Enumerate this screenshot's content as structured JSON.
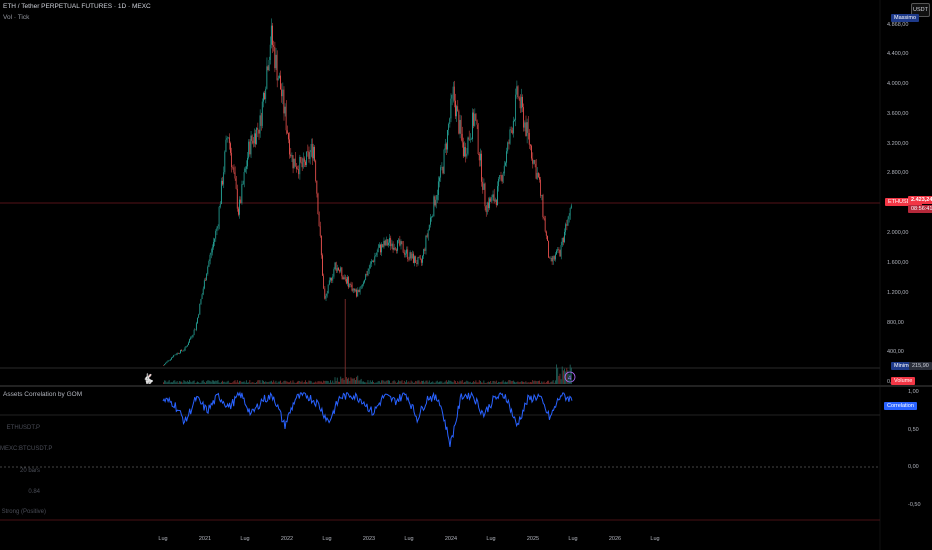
{
  "header": {
    "symbol_title": "ETH / Tether PERPETUAL FUTURES · 1D · MEXC",
    "sub_label": "Vol · Tick"
  },
  "currency_button": "USDT",
  "price_axis": {
    "ticks": [
      "4.400,00",
      "4.000,00",
      "3.600,00",
      "3.200,00",
      "2.800,00",
      "2.000,00",
      "1.600,00",
      "1.200,00",
      "800,00",
      "400,00",
      "0,00"
    ],
    "max_tag": "Massimo",
    "max_value": "4.868,00",
    "min_tag": "Minimo",
    "min_value": "215,90",
    "volume_tag": "Volume",
    "last_tag": "ETHUSDT.P",
    "last_price": "2.423,24",
    "countdown": "08:56:41"
  },
  "indicator": {
    "title": "Assets Correlation by GOM",
    "legend_tag": "Correlation",
    "axis_ticks": [
      "1,00",
      "0,50",
      "0,00",
      "-0,50"
    ],
    "table": [
      "ETHUSDT.P",
      "MEXC:BTCUSDT.P",
      "20 bars",
      "0.84",
      "Strong (Positive)"
    ]
  },
  "x_axis": [
    "Lug",
    "2021",
    "Lug",
    "2022",
    "Lug",
    "2023",
    "Lug",
    "2024",
    "Lug",
    "2025",
    "Lug",
    "2026",
    "Lug"
  ],
  "colors": {
    "background": "#000000",
    "up": "#26a69a",
    "down": "#ef5350",
    "correlation_line": "#2962ff",
    "max_tag": "#1e3a8a",
    "last_price_tag": "#f23645",
    "volume_tag": "#f23645"
  },
  "chart_data": [
    {
      "type": "candlestick",
      "title": "ETH / Tether PERPETUAL FUTURES · 1D · MEXC",
      "ylim": [
        0,
        4868
      ],
      "x": [
        "2020-07",
        "2020-09",
        "2020-11",
        "2021-01",
        "2021-02",
        "2021-04",
        "2021-05",
        "2021-06",
        "2021-08",
        "2021-09",
        "2021-11",
        "2021-12",
        "2022-01",
        "2022-03",
        "2022-04",
        "2022-06",
        "2022-07",
        "2022-09",
        "2022-11",
        "2023-01",
        "2023-03",
        "2023-04",
        "2023-06",
        "2023-08",
        "2023-10",
        "2023-12",
        "2024-02",
        "2024-03",
        "2024-04",
        "2024-06",
        "2024-08",
        "2024-09",
        "2024-11",
        "2024-12",
        "2025-01",
        "2025-02",
        "2025-04",
        "2025-05",
        "2025-06"
      ],
      "close": [
        240,
        380,
        460,
        750,
        1500,
        2100,
        3400,
        2300,
        3200,
        3500,
        4700,
        3900,
        3000,
        2900,
        3200,
        1100,
        1600,
        1400,
        1200,
        1500,
        1800,
        1900,
        1850,
        1700,
        1600,
        2300,
        2900,
        3900,
        3100,
        3600,
        2400,
        2500,
        3100,
        3900,
        3300,
        2700,
        1600,
        1800,
        2500
      ]
    },
    {
      "type": "line",
      "title": "Assets Correlation by GOM",
      "series": [
        {
          "name": "Correlation",
          "values": [
            0.9,
            0.85,
            0.6,
            0.92,
            0.75,
            0.95,
            0.8,
            0.98,
            0.7,
            0.9,
            0.95,
            0.55,
            0.92,
            0.96,
            0.85,
            0.6,
            0.93,
            0.97,
            0.9,
            0.72,
            0.95,
            0.88,
            0.98,
            0.65,
            0.94,
            0.9,
            0.3,
            0.95,
            0.97,
            0.7,
            0.92,
            0.96,
            0.55,
            0.9,
            0.95,
            0.65,
            0.97,
            0.9
          ]
        }
      ],
      "ylim": [
        -0.5,
        1.0
      ]
    }
  ]
}
